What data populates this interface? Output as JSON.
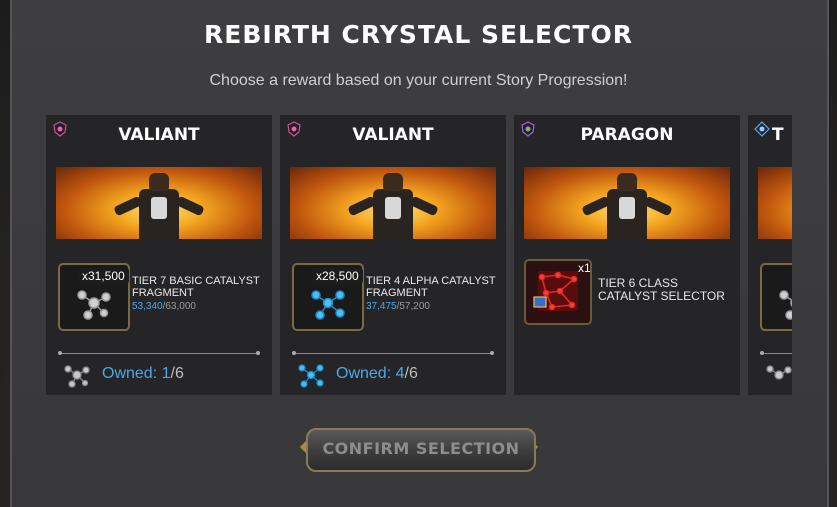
{
  "header": {
    "title": "REBIRTH CRYSTAL SELECTOR",
    "subtitle": "Choose a reward based on your current Story Progression!"
  },
  "cards": [
    {
      "title": "VALIANT",
      "icon": "valiant-crest-icon",
      "item": {
        "quantity": "x31,500",
        "name": "TIER 7 BASIC CATALYST FRAGMENT",
        "owned_current": "53,340",
        "owned_sep": "/",
        "owned_max": "63,000"
      },
      "owned": {
        "label": "Owned: ",
        "current": "1",
        "sep": "/",
        "max": "6"
      }
    },
    {
      "title": "VALIANT",
      "icon": "valiant-crest-icon",
      "item": {
        "quantity": "x28,500",
        "name": "TIER 4 ALPHA CATALYST FRAGMENT",
        "owned_current": "37,475",
        "owned_sep": "/",
        "owned_max": "57,200"
      },
      "owned": {
        "label": "Owned: ",
        "current": "4",
        "sep": "/",
        "max": "6"
      }
    },
    {
      "title": "PARAGON",
      "icon": "paragon-crest-icon",
      "item": {
        "quantity": "x1",
        "name": "TIER 6 CLASS CATALYST SELECTOR"
      }
    },
    {
      "title": "T",
      "icon": "thronebreaker-crest-icon"
    }
  ],
  "confirm": {
    "label": "CONFIRM SELECTION"
  },
  "colors": {
    "accent_blue": "#4aa8e8",
    "gold_frame": "#8a7a55"
  }
}
